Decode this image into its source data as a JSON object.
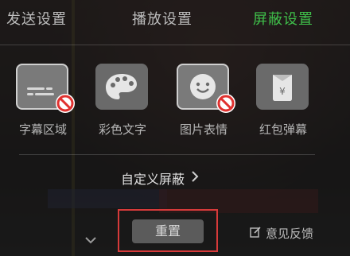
{
  "tabs": [
    {
      "label": "发送设置"
    },
    {
      "label": "播放设置"
    },
    {
      "label": "屏蔽设置"
    }
  ],
  "colors": {
    "accent": "#3fbf4a",
    "highlight_outline": "#d63a3a"
  },
  "options": [
    {
      "label": "字幕区域",
      "icon": "subtitle-icon",
      "blocked": true
    },
    {
      "label": "彩色文字",
      "icon": "palette-icon",
      "blocked": false
    },
    {
      "label": "图片表情",
      "icon": "emoji-icon",
      "blocked": true
    },
    {
      "label": "红包弹幕",
      "icon": "red-envelope-icon",
      "blocked": false
    }
  ],
  "custom_block": {
    "label": "自定义屏蔽"
  },
  "actions": {
    "reset_label": "重置",
    "feedback_label": "意见反馈"
  }
}
